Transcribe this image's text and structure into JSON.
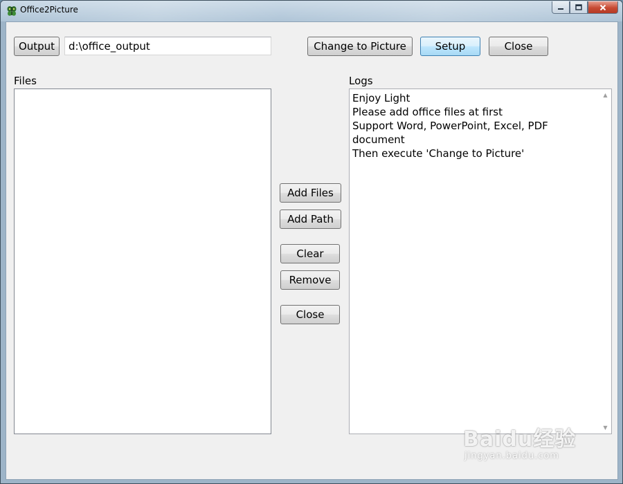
{
  "window": {
    "title": "Office2Picture"
  },
  "toolbar": {
    "output_label": "Output",
    "output_path": "d:\\office_output",
    "change_label": "Change to Picture",
    "setup_label": "Setup",
    "close_label": "Close"
  },
  "files": {
    "label": "Files",
    "items": []
  },
  "middle_buttons": {
    "add_files": "Add Files",
    "add_path": "Add Path",
    "clear": "Clear",
    "remove": "Remove",
    "close": "Close"
  },
  "logs": {
    "label": "Logs",
    "lines": [
      "Enjoy Light",
      "Please add office files at first",
      "Support Word, PowerPoint, Excel, PDF",
      "document",
      "Then execute 'Change to Picture'"
    ]
  },
  "watermark": {
    "main": "Baidu经验",
    "sub": "jingyan.baidu.com"
  },
  "colors": {
    "focused_button": "#bee6fd",
    "client_bg": "#f0f0f0"
  },
  "icons": {
    "app": "butterfly-icon",
    "minimize": "minimize-icon",
    "maximize": "maximize-icon",
    "close": "close-icon"
  }
}
